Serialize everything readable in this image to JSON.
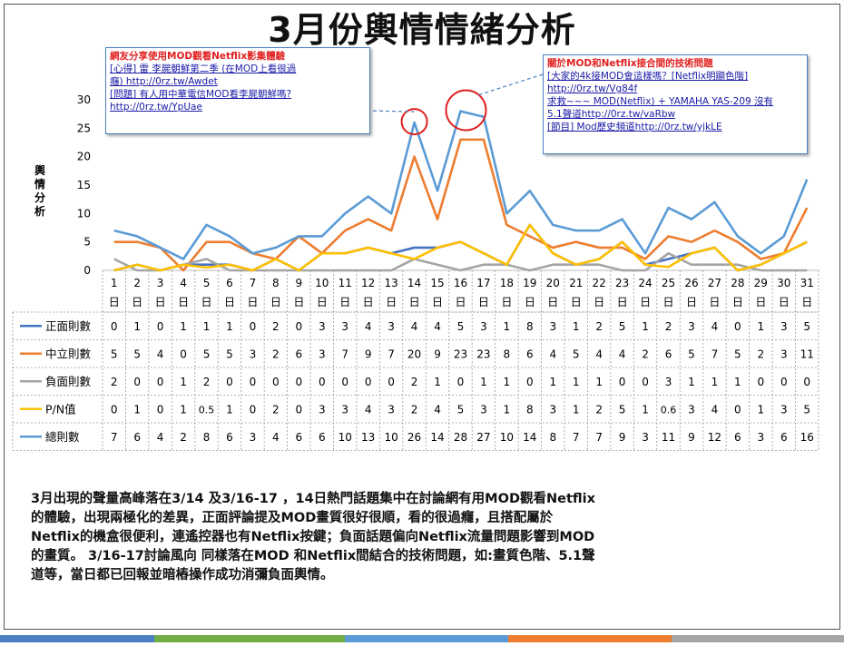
{
  "title": "3月份輿情情緒分析",
  "callouts": {
    "left": {
      "title": "網友分享使用MOD觀看Netflix影集體驗",
      "lines": [
        "[心得] 雷 李屍朝鮮第二季 (在MOD上看很過",
        "癮) http://0rz.tw/Awdet",
        "[問題] 有人用中華電信MOD看李屍朝鮮嗎?",
        "http://0rz.tw/YpUae"
      ]
    },
    "right": {
      "title": "關於MOD和Netflix接合間的技術問題",
      "lines": [
        "[大家的4k接MOD會這樣嗎？[Netflix明顯色階]",
        "http://0rz.tw/Vg84f",
        "求救~~~ MOD(Netflix) + YAMAHA YAS-209 沒有",
        "5.1聲道http://0rz.tw/vaRbw",
        "[節目] Mod歷史頻道http://0rz.tw/yjkLE"
      ]
    }
  },
  "description": [
    "3月出現的聲量高峰落在3/14 及3/16-17 ，14日熱門話題集中在討論網有用MOD觀看Netflix",
    "的體驗，出現兩極化的差異，正面評論提及MOD畫質很好很順，看的很過癮，且搭配屬於",
    "Netflix的機盒很便利，連遙控器也有Netflix按鍵；負面話題偏向Netflix流量問題影響到MOD",
    "的畫質。 3/16-17討論風向 同樣落在MOD 和Netflix間結合的技術問題，如:畫質色階、5.1聲",
    "道等，當日都已回報並暗樁操作成功消彌負面輿情。"
  ],
  "footer_colors": [
    "#4a7fc1",
    "#70ad47",
    "#5b9bd5",
    "#ed7d31",
    "#a5a5a5"
  ],
  "chart_data": {
    "type": "line",
    "ylabel": "輿情分析",
    "ylim": [
      0,
      30
    ],
    "yticks": [
      0,
      5,
      10,
      15,
      20,
      25,
      30
    ],
    "day_suffix": "日",
    "categories": [
      "1",
      "2",
      "3",
      "4",
      "5",
      "6",
      "7",
      "8",
      "9",
      "10",
      "11",
      "12",
      "13",
      "14",
      "15",
      "16",
      "17",
      "18",
      "19",
      "20",
      "21",
      "22",
      "23",
      "24",
      "25",
      "26",
      "27",
      "28",
      "29",
      "30",
      "31"
    ],
    "grid": false,
    "legend": "table-left",
    "series": [
      {
        "name": "正面則數",
        "color": "#4472c4",
        "values": [
          0,
          1,
          0,
          1,
          1,
          1,
          0,
          2,
          0,
          3,
          3,
          4,
          3,
          4,
          4,
          5,
          3,
          1,
          8,
          3,
          1,
          2,
          5,
          1,
          2,
          3,
          4,
          0,
          1,
          3,
          5
        ],
        "labels": [
          "0",
          "1",
          "0",
          "1",
          "1",
          "1",
          "0",
          "2",
          "0",
          "3",
          "3",
          "4",
          "3",
          "4",
          "4",
          "5",
          "3",
          "1",
          "8",
          "3",
          "1",
          "2",
          "5",
          "1",
          "2",
          "3",
          "4",
          "0",
          "1",
          "3",
          "5"
        ]
      },
      {
        "name": "中立則數",
        "color": "#ed7d31",
        "values": [
          5,
          5,
          4,
          0,
          5,
          5,
          3,
          2,
          6,
          3,
          7,
          9,
          7,
          20,
          9,
          23,
          23,
          8,
          6,
          4,
          5,
          4,
          4,
          2,
          6,
          5,
          7,
          5,
          2,
          3,
          11
        ],
        "labels": [
          "5",
          "5",
          "4",
          "0",
          "5",
          "5",
          "3",
          "2",
          "6",
          "3",
          "7",
          "9",
          "7",
          "20",
          "9",
          "23",
          "23",
          "8",
          "6",
          "4",
          "5",
          "4",
          "4",
          "2",
          "6",
          "5",
          "7",
          "5",
          "2",
          "3",
          "11"
        ]
      },
      {
        "name": "負面則數",
        "color": "#a5a5a5",
        "values": [
          2,
          0,
          0,
          1,
          2,
          0,
          0,
          0,
          0,
          0,
          0,
          0,
          0,
          2,
          1,
          0,
          1,
          1,
          0,
          1,
          1,
          1,
          0,
          0,
          3,
          1,
          1,
          1,
          0,
          0,
          0
        ],
        "labels": [
          "2",
          "0",
          "0",
          "1",
          "2",
          "0",
          "0",
          "0",
          "0",
          "0",
          "0",
          "0",
          "0",
          "2",
          "1",
          "0",
          "1",
          "1",
          "0",
          "1",
          "1",
          "1",
          "0",
          "0",
          "3",
          "1",
          "1",
          "1",
          "0",
          "0",
          "0"
        ]
      },
      {
        "name": "P/N值",
        "color": "#ffc000",
        "values": [
          0,
          1,
          0,
          1,
          0.5,
          1,
          0,
          2,
          0,
          3,
          3,
          4,
          3,
          2,
          4,
          5,
          3,
          1,
          8,
          3,
          1,
          2,
          5,
          1,
          0.6,
          3,
          4,
          0,
          1,
          3,
          5
        ],
        "labels": [
          "0",
          "1",
          "0",
          "1",
          "0.5",
          "1",
          "0",
          "2",
          "0",
          "3",
          "3",
          "4",
          "3",
          "2",
          "4",
          "5",
          "3",
          "1",
          "8",
          "3",
          "1",
          "2",
          "5",
          "1",
          "0.6",
          "3",
          "4",
          "0",
          "1",
          "3",
          "5"
        ]
      },
      {
        "name": "總則數",
        "color": "#5b9bd5",
        "values": [
          7,
          6,
          4,
          2,
          8,
          6,
          3,
          4,
          6,
          6,
          10,
          13,
          10,
          26,
          14,
          28,
          27,
          10,
          14,
          8,
          7,
          7,
          9,
          3,
          11,
          9,
          12,
          6,
          3,
          6,
          16
        ],
        "labels": [
          "7",
          "6",
          "4",
          "2",
          "8",
          "6",
          "3",
          "4",
          "6",
          "6",
          "10",
          "13",
          "10",
          "26",
          "14",
          "28",
          "27",
          "10",
          "14",
          "8",
          "7",
          "7",
          "9",
          "3",
          "11",
          "9",
          "12",
          "6",
          "3",
          "6",
          "16"
        ]
      }
    ],
    "highlight_days": [
      "14",
      "16"
    ]
  }
}
